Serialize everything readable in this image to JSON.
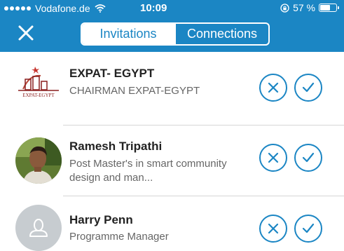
{
  "status_bar": {
    "carrier": "Vodafone.de",
    "time": "10:09",
    "battery_percent": "57 %",
    "battery_level": 0.57
  },
  "header": {
    "close_icon": "close-icon",
    "tabs": [
      {
        "label": "Invitations",
        "selected": true
      },
      {
        "label": "Connections",
        "selected": false
      }
    ]
  },
  "invitations": [
    {
      "name": "EXPAT- EGYPT",
      "subtitle": "CHAIRMAN  EXPAT-EGYPT",
      "avatar": "company-logo",
      "logo_text": "EXPAT-EGYPT"
    },
    {
      "name": "Ramesh Tripathi",
      "subtitle": "Post Master's in smart community design and man...",
      "avatar": "profile-photo"
    },
    {
      "name": "Harry Penn",
      "subtitle": "Programme Manager",
      "avatar": "default-avatar"
    }
  ],
  "colors": {
    "brand": "#1b86c4",
    "text": "#222222",
    "subtext": "#666666"
  }
}
